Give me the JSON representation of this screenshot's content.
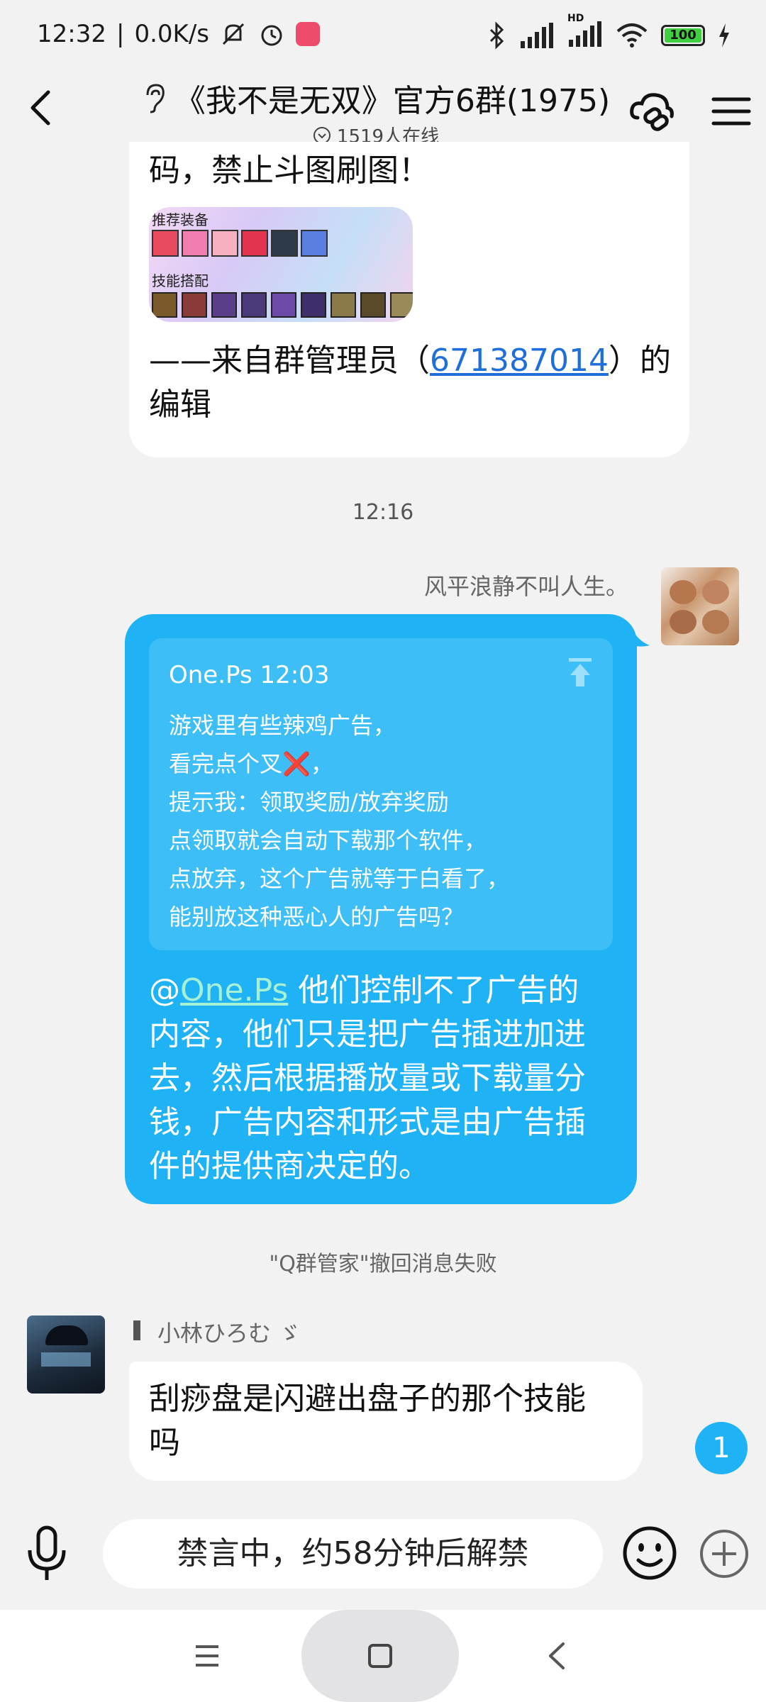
{
  "status_bar": {
    "time": "12:32",
    "separator": "|",
    "speed": "0.0K/s",
    "battery": "100",
    "hd_label": "HD"
  },
  "header": {
    "title": "《我不是无双》官方6群(1975)",
    "online": "1519人在线"
  },
  "messages": {
    "announcement": {
      "line1": "码，禁止斗图刷图！",
      "image_label_1": "推荐装备",
      "image_label_2": "技能搭配",
      "footer_prefix": "——来自群管理员（",
      "admin_id": "671387014",
      "footer_suffix": "）的",
      "footer_line2": "编辑"
    },
    "time_1": "12:16",
    "reply": {
      "sender": "风平浪静不叫人生。",
      "quote_author": "One.Ps 12:03",
      "quote_lines": [
        "游戏里有些辣鸡广告，",
        "看完点个叉❌，",
        "提示我：领取奖励/放弃奖励",
        "点领取就会自动下载那个软件，",
        "点放弃，这个广告就等于白看了，",
        "能别放这种恶心人的广告吗？"
      ],
      "mention_at": "@",
      "mention": "One.Ps",
      "text_line1": " 他们控制不了广告的",
      "text_line2": "内容，他们只是把广告插进加进",
      "text_line3": "去，然后根据播放量或下载量分",
      "text_line4": "钱，广告内容和形式是由广告插",
      "text_line5": "件的提供商决定的。"
    },
    "system_note": "\"Q群管家\"撤回消息失败",
    "incoming": {
      "sender": "小林ひろむ ゞ",
      "line1": "刮痧盘是闪避出盘子的那个技能",
      "line2": "吗"
    }
  },
  "unread_badge": "1",
  "input": {
    "placeholder": "禁言中，约58分钟后解禁"
  },
  "colors": {
    "accent": "#1fb2f4",
    "link": "#1e6fd9",
    "background": "#f2f2f3"
  },
  "icons": [
    "back-arrow-icon",
    "ear-icon",
    "chevron-circle-icon",
    "cloud-link-icon",
    "menu-icon",
    "mic-icon",
    "emoji-icon",
    "plus-icon",
    "pin-top-icon"
  ]
}
